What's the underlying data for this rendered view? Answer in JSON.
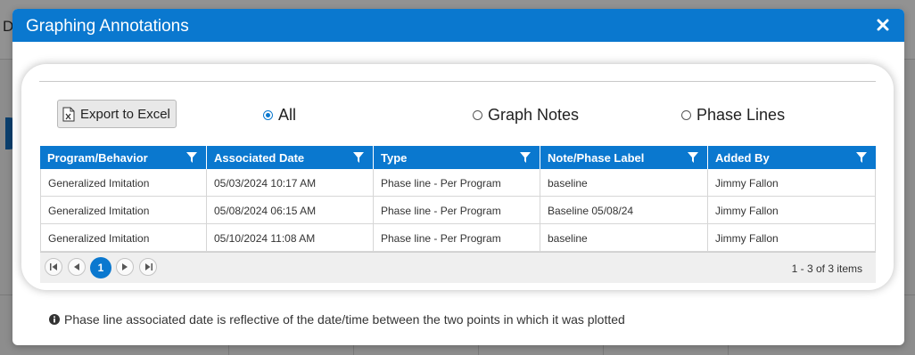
{
  "background": {
    "partial_letter": "D"
  },
  "modal": {
    "title": "Graphing Annotations",
    "close_glyph": "✕",
    "accent_color": "#0a78cf"
  },
  "toolbar": {
    "export_label": "Export to Excel",
    "export_icon": "excel-file-icon"
  },
  "filters": {
    "options": [
      {
        "label": "All",
        "checked": true
      },
      {
        "label": "Graph Notes",
        "checked": false
      },
      {
        "label": "Phase Lines",
        "checked": false
      }
    ]
  },
  "table": {
    "columns": [
      "Program/Behavior",
      "Associated Date",
      "Type",
      "Note/Phase Label",
      "Added By"
    ],
    "rows": [
      [
        "Generalized Imitation",
        "05/03/2024 10:17 AM",
        "Phase line - Per Program",
        "baseline",
        "Jimmy Fallon"
      ],
      [
        "Generalized Imitation",
        "05/08/2024 06:15 AM",
        "Phase line - Per Program",
        "Baseline 05/08/24",
        "Jimmy Fallon"
      ],
      [
        "Generalized Imitation",
        "05/10/2024 11:08 AM",
        "Phase line - Per Program",
        "baseline",
        "Jimmy Fallon"
      ]
    ]
  },
  "pager": {
    "current_page": "1",
    "summary": "1 - 3 of 3 items"
  },
  "footer": {
    "note": "Phase line associated date is reflective of the date/time between the two points in which it was plotted"
  }
}
